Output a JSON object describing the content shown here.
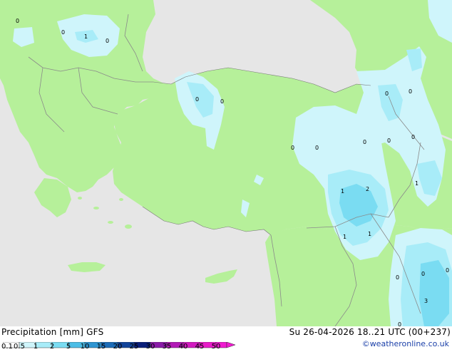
{
  "header": {
    "left_title": "Precipitation [mm]  GFS",
    "right_title": "Su 26-04-2026 18..21 UTC (00+237)"
  },
  "credit": "©weatheronline.co.uk",
  "legend": {
    "labels": [
      "0.1",
      "0.5",
      "1",
      "2",
      "5",
      "10",
      "15",
      "20",
      "25",
      "30",
      "35",
      "40",
      "45",
      "50"
    ],
    "colors": [
      "#ffffff",
      "#cff5fb",
      "#a8ecf8",
      "#7adcf2",
      "#4cbde6",
      "#2e95d2",
      "#1c6cb8",
      "#12449a",
      "#0a1f7a",
      "#8a1aa8",
      "#b21ab6",
      "#d21ac0",
      "#e81ac8",
      "#f01ad0"
    ]
  },
  "map": {
    "colors": {
      "sea": "#e6e6e6",
      "land": "#b6f09a",
      "light_rain": "#cff5fb",
      "medium_rain": "#a8ecf8",
      "heavy_rain": "#7adcf2",
      "border": "#8a8a8a",
      "coast": "#777777"
    },
    "values": [
      {
        "text": "0"
      },
      {
        "text": "0"
      },
      {
        "text": "1"
      },
      {
        "text": "0"
      },
      {
        "text": "0"
      },
      {
        "text": "0"
      },
      {
        "text": "0"
      },
      {
        "text": "0"
      },
      {
        "text": "0"
      },
      {
        "text": "0"
      },
      {
        "text": "0"
      },
      {
        "text": "0"
      },
      {
        "text": "0"
      },
      {
        "text": "1"
      },
      {
        "text": "1"
      },
      {
        "text": "2"
      },
      {
        "text": "1"
      },
      {
        "text": "1"
      },
      {
        "text": "0"
      },
      {
        "text": "0"
      },
      {
        "text": "0"
      },
      {
        "text": "0"
      },
      {
        "text": "3"
      }
    ]
  }
}
